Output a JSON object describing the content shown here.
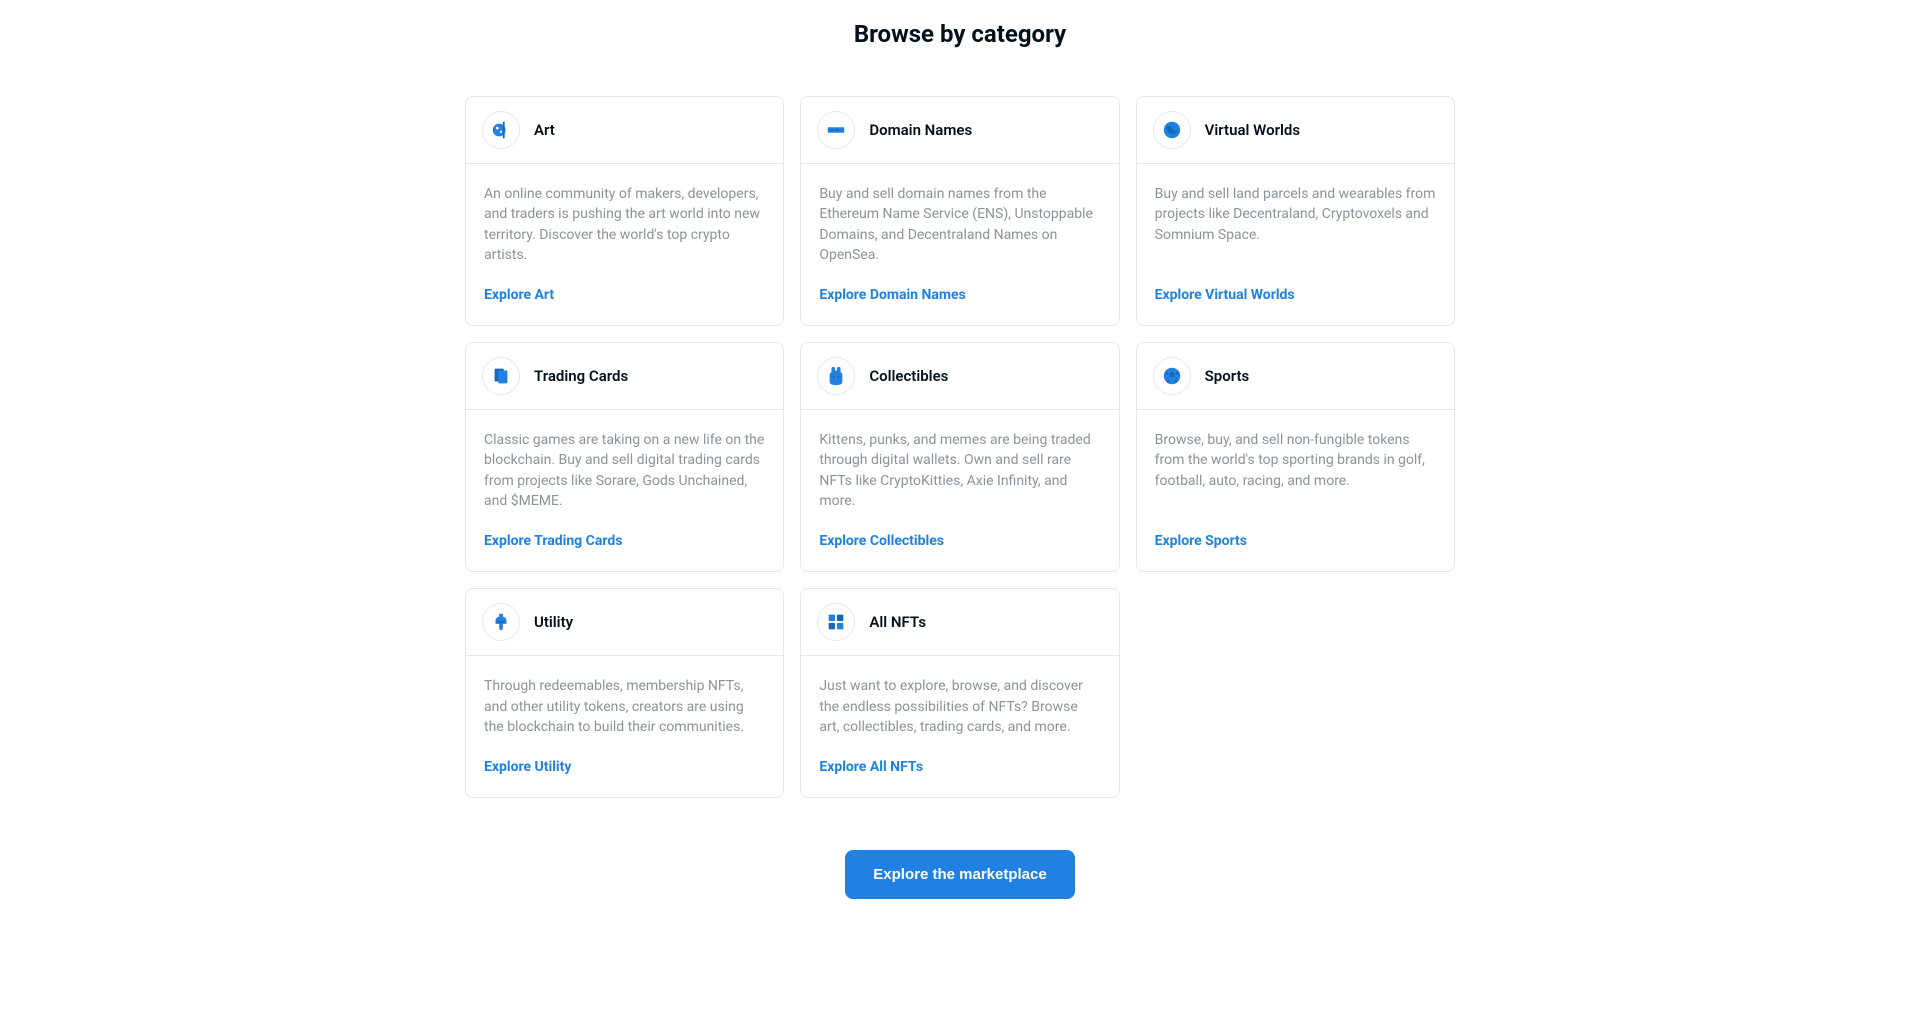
{
  "title": "Browse by category",
  "cta": "Explore the marketplace",
  "categories": [
    {
      "name": "Art",
      "description": "An online community of makers, developers, and traders is pushing the art world into new territory. Discover the world's top crypto artists.",
      "link": "Explore Art"
    },
    {
      "name": "Domain Names",
      "description": "Buy and sell domain names from the Ethereum Name Service (ENS), Unstoppable Domains, and Decentraland Names on OpenSea.",
      "link": "Explore Domain Names"
    },
    {
      "name": "Virtual Worlds",
      "description": "Buy and sell land parcels and wearables from projects like Decentraland, Cryptovoxels and Somnium Space.",
      "link": "Explore Virtual Worlds"
    },
    {
      "name": "Trading Cards",
      "description": "Classic games are taking on a new life on the blockchain. Buy and sell digital trading cards from projects like Sorare, Gods Unchained, and $MEME.",
      "link": "Explore Trading Cards"
    },
    {
      "name": "Collectibles",
      "description": "Kittens, punks, and memes are being traded through digital wallets. Own and sell rare NFTs like CryptoKitties, Axie Infinity, and more.",
      "link": "Explore Collectibles"
    },
    {
      "name": "Sports",
      "description": "Browse, buy, and sell non-fungible tokens from the world's top sporting brands in golf, football, auto, racing, and more.",
      "link": "Explore Sports"
    },
    {
      "name": "Utility",
      "description": "Through redeemables, membership NFTs, and other utility tokens, creators are using the blockchain to build their communities.",
      "link": "Explore Utility"
    },
    {
      "name": "All NFTs",
      "description": "Just want to explore, browse, and discover the endless possibilities of NFTs? Browse art, collectibles, trading cards, and more.",
      "link": "Explore All NFTs"
    }
  ]
}
